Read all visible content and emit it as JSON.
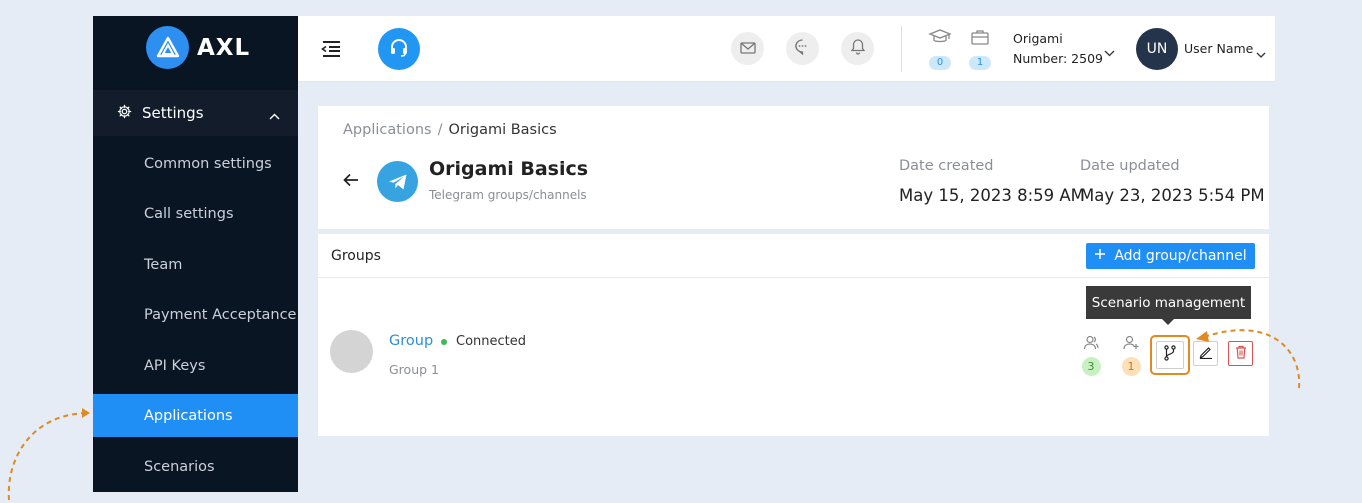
{
  "brand": {
    "name": "AXL",
    "color": "#2d8ff0"
  },
  "sidebar": {
    "section": {
      "label": "Settings",
      "icon": "gear-icon",
      "expanded": true
    },
    "items": [
      {
        "label": "Common settings",
        "active": false
      },
      {
        "label": "Call settings",
        "active": false
      },
      {
        "label": "Team",
        "active": false
      },
      {
        "label": "Payment Acceptance",
        "active": false
      },
      {
        "label": "API Keys",
        "active": false
      },
      {
        "label": "Applications",
        "active": true
      },
      {
        "label": "Scenarios",
        "active": false
      }
    ]
  },
  "header": {
    "icons": [
      "menu-collapse-icon",
      "headset-icon",
      "mail-icon",
      "chat-icon",
      "bell-icon"
    ],
    "counters": [
      {
        "icon": "graduation-cap-icon",
        "count": "0"
      },
      {
        "icon": "briefcase-icon",
        "count": "1"
      }
    ],
    "company": {
      "name": "Origami",
      "number_label": "Number: 2509"
    },
    "user": {
      "initials": "UN",
      "name": "User Name"
    }
  },
  "app": {
    "breadcrumb": {
      "parent": "Applications",
      "separator": "/",
      "current": "Origami Basics"
    },
    "title": "Origami Basics",
    "subtitle": "Telegram groups/channels",
    "date_created_label": "Date created",
    "date_created": "May 15, 2023 8:59 AM",
    "date_updated_label": "Date updated",
    "date_updated": "May 23, 2023 5:54 PM"
  },
  "groups": {
    "title": "Groups",
    "add_button": "Add group/channel",
    "tooltip": "Scenario management",
    "rows": [
      {
        "name": "Group",
        "status": "Connected",
        "status_color": "#3fb950",
        "subtitle": "Group 1",
        "members_count": "3",
        "added_count": "1"
      }
    ]
  },
  "colors": {
    "accent": "#1f8ff5",
    "highlight": "#e08a22",
    "sidebar_bg": "#0a1524"
  }
}
